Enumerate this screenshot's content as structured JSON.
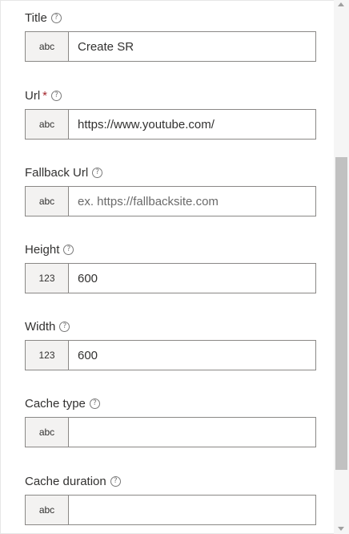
{
  "fields": [
    {
      "label": "Title",
      "required": false,
      "type_badge": "abc",
      "value": "Create SR",
      "placeholder": ""
    },
    {
      "label": "Url",
      "required": true,
      "required_marker": "*",
      "type_badge": "abc",
      "value": "https://www.youtube.com/",
      "placeholder": ""
    },
    {
      "label": "Fallback Url",
      "required": false,
      "type_badge": "abc",
      "value": "",
      "placeholder": "ex. https://fallbacksite.com"
    },
    {
      "label": "Height",
      "required": false,
      "type_badge": "123",
      "value": "600",
      "placeholder": ""
    },
    {
      "label": "Width",
      "required": false,
      "type_badge": "123",
      "value": "600",
      "placeholder": ""
    },
    {
      "label": "Cache type",
      "required": false,
      "type_badge": "abc",
      "value": "",
      "placeholder": ""
    },
    {
      "label": "Cache duration",
      "required": false,
      "type_badge": "abc",
      "value": "",
      "placeholder": ""
    }
  ],
  "help_icon_glyph": "?",
  "colors": {
    "required": "#a4262c",
    "border": "#8a8886",
    "badge_bg": "#f3f2f1",
    "scroll_thumb": "#c1c1c1"
  },
  "icons": {
    "help": "help-circle-icon",
    "scroll_up": "scroll-up-arrow-icon",
    "scroll_down": "scroll-down-arrow-icon"
  },
  "scrollbar": {
    "thumb_start_fraction": 0.294,
    "thumb_size_fraction": 0.586
  }
}
